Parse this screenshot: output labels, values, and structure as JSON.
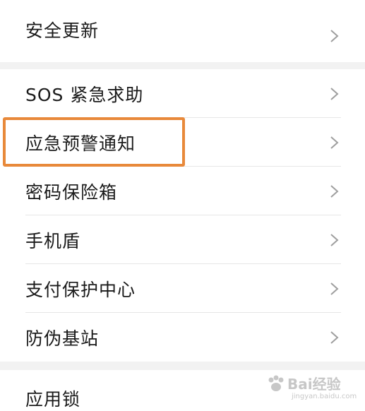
{
  "settings_list": {
    "group1": [
      {
        "label": "安全更新"
      }
    ],
    "group2": [
      {
        "label": "SOS 紧急求助"
      },
      {
        "label": "应急预警通知"
      },
      {
        "label": "密码保险箱"
      },
      {
        "label": "手机盾"
      },
      {
        "label": "支付保护中心"
      },
      {
        "label": "防伪基站"
      }
    ],
    "group3": [
      {
        "label": "应用锁"
      }
    ]
  },
  "chevron_icon": "chevron-right-icon",
  "highlight_color": "#e8893a",
  "watermark": {
    "text": "Bai经验",
    "sub": "jingyan.baidu.com"
  }
}
